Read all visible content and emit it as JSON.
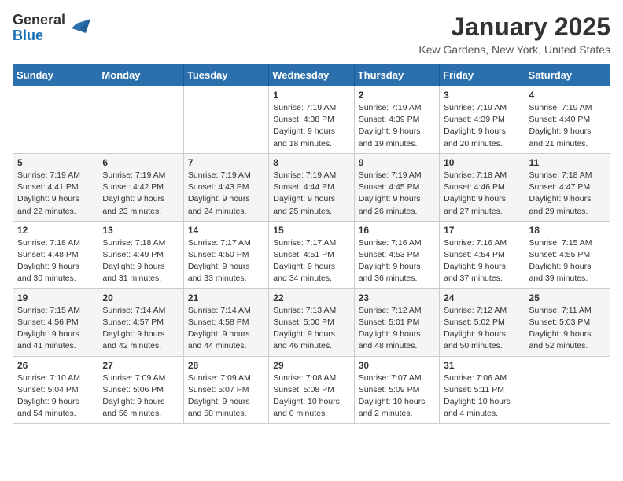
{
  "logo": {
    "general": "General",
    "blue": "Blue"
  },
  "title": "January 2025",
  "location": "Kew Gardens, New York, United States",
  "days_of_week": [
    "Sunday",
    "Monday",
    "Tuesday",
    "Wednesday",
    "Thursday",
    "Friday",
    "Saturday"
  ],
  "weeks": [
    [
      {
        "day": "",
        "info": ""
      },
      {
        "day": "",
        "info": ""
      },
      {
        "day": "",
        "info": ""
      },
      {
        "day": "1",
        "info": "Sunrise: 7:19 AM\nSunset: 4:38 PM\nDaylight: 9 hours\nand 18 minutes."
      },
      {
        "day": "2",
        "info": "Sunrise: 7:19 AM\nSunset: 4:39 PM\nDaylight: 9 hours\nand 19 minutes."
      },
      {
        "day": "3",
        "info": "Sunrise: 7:19 AM\nSunset: 4:39 PM\nDaylight: 9 hours\nand 20 minutes."
      },
      {
        "day": "4",
        "info": "Sunrise: 7:19 AM\nSunset: 4:40 PM\nDaylight: 9 hours\nand 21 minutes."
      }
    ],
    [
      {
        "day": "5",
        "info": "Sunrise: 7:19 AM\nSunset: 4:41 PM\nDaylight: 9 hours\nand 22 minutes."
      },
      {
        "day": "6",
        "info": "Sunrise: 7:19 AM\nSunset: 4:42 PM\nDaylight: 9 hours\nand 23 minutes."
      },
      {
        "day": "7",
        "info": "Sunrise: 7:19 AM\nSunset: 4:43 PM\nDaylight: 9 hours\nand 24 minutes."
      },
      {
        "day": "8",
        "info": "Sunrise: 7:19 AM\nSunset: 4:44 PM\nDaylight: 9 hours\nand 25 minutes."
      },
      {
        "day": "9",
        "info": "Sunrise: 7:19 AM\nSunset: 4:45 PM\nDaylight: 9 hours\nand 26 minutes."
      },
      {
        "day": "10",
        "info": "Sunrise: 7:18 AM\nSunset: 4:46 PM\nDaylight: 9 hours\nand 27 minutes."
      },
      {
        "day": "11",
        "info": "Sunrise: 7:18 AM\nSunset: 4:47 PM\nDaylight: 9 hours\nand 29 minutes."
      }
    ],
    [
      {
        "day": "12",
        "info": "Sunrise: 7:18 AM\nSunset: 4:48 PM\nDaylight: 9 hours\nand 30 minutes."
      },
      {
        "day": "13",
        "info": "Sunrise: 7:18 AM\nSunset: 4:49 PM\nDaylight: 9 hours\nand 31 minutes."
      },
      {
        "day": "14",
        "info": "Sunrise: 7:17 AM\nSunset: 4:50 PM\nDaylight: 9 hours\nand 33 minutes."
      },
      {
        "day": "15",
        "info": "Sunrise: 7:17 AM\nSunset: 4:51 PM\nDaylight: 9 hours\nand 34 minutes."
      },
      {
        "day": "16",
        "info": "Sunrise: 7:16 AM\nSunset: 4:53 PM\nDaylight: 9 hours\nand 36 minutes."
      },
      {
        "day": "17",
        "info": "Sunrise: 7:16 AM\nSunset: 4:54 PM\nDaylight: 9 hours\nand 37 minutes."
      },
      {
        "day": "18",
        "info": "Sunrise: 7:15 AM\nSunset: 4:55 PM\nDaylight: 9 hours\nand 39 minutes."
      }
    ],
    [
      {
        "day": "19",
        "info": "Sunrise: 7:15 AM\nSunset: 4:56 PM\nDaylight: 9 hours\nand 41 minutes."
      },
      {
        "day": "20",
        "info": "Sunrise: 7:14 AM\nSunset: 4:57 PM\nDaylight: 9 hours\nand 42 minutes."
      },
      {
        "day": "21",
        "info": "Sunrise: 7:14 AM\nSunset: 4:58 PM\nDaylight: 9 hours\nand 44 minutes."
      },
      {
        "day": "22",
        "info": "Sunrise: 7:13 AM\nSunset: 5:00 PM\nDaylight: 9 hours\nand 46 minutes."
      },
      {
        "day": "23",
        "info": "Sunrise: 7:12 AM\nSunset: 5:01 PM\nDaylight: 9 hours\nand 48 minutes."
      },
      {
        "day": "24",
        "info": "Sunrise: 7:12 AM\nSunset: 5:02 PM\nDaylight: 9 hours\nand 50 minutes."
      },
      {
        "day": "25",
        "info": "Sunrise: 7:11 AM\nSunset: 5:03 PM\nDaylight: 9 hours\nand 52 minutes."
      }
    ],
    [
      {
        "day": "26",
        "info": "Sunrise: 7:10 AM\nSunset: 5:04 PM\nDaylight: 9 hours\nand 54 minutes."
      },
      {
        "day": "27",
        "info": "Sunrise: 7:09 AM\nSunset: 5:06 PM\nDaylight: 9 hours\nand 56 minutes."
      },
      {
        "day": "28",
        "info": "Sunrise: 7:09 AM\nSunset: 5:07 PM\nDaylight: 9 hours\nand 58 minutes."
      },
      {
        "day": "29",
        "info": "Sunrise: 7:08 AM\nSunset: 5:08 PM\nDaylight: 10 hours\nand 0 minutes."
      },
      {
        "day": "30",
        "info": "Sunrise: 7:07 AM\nSunset: 5:09 PM\nDaylight: 10 hours\nand 2 minutes."
      },
      {
        "day": "31",
        "info": "Sunrise: 7:06 AM\nSunset: 5:11 PM\nDaylight: 10 hours\nand 4 minutes."
      },
      {
        "day": "",
        "info": ""
      }
    ]
  ]
}
